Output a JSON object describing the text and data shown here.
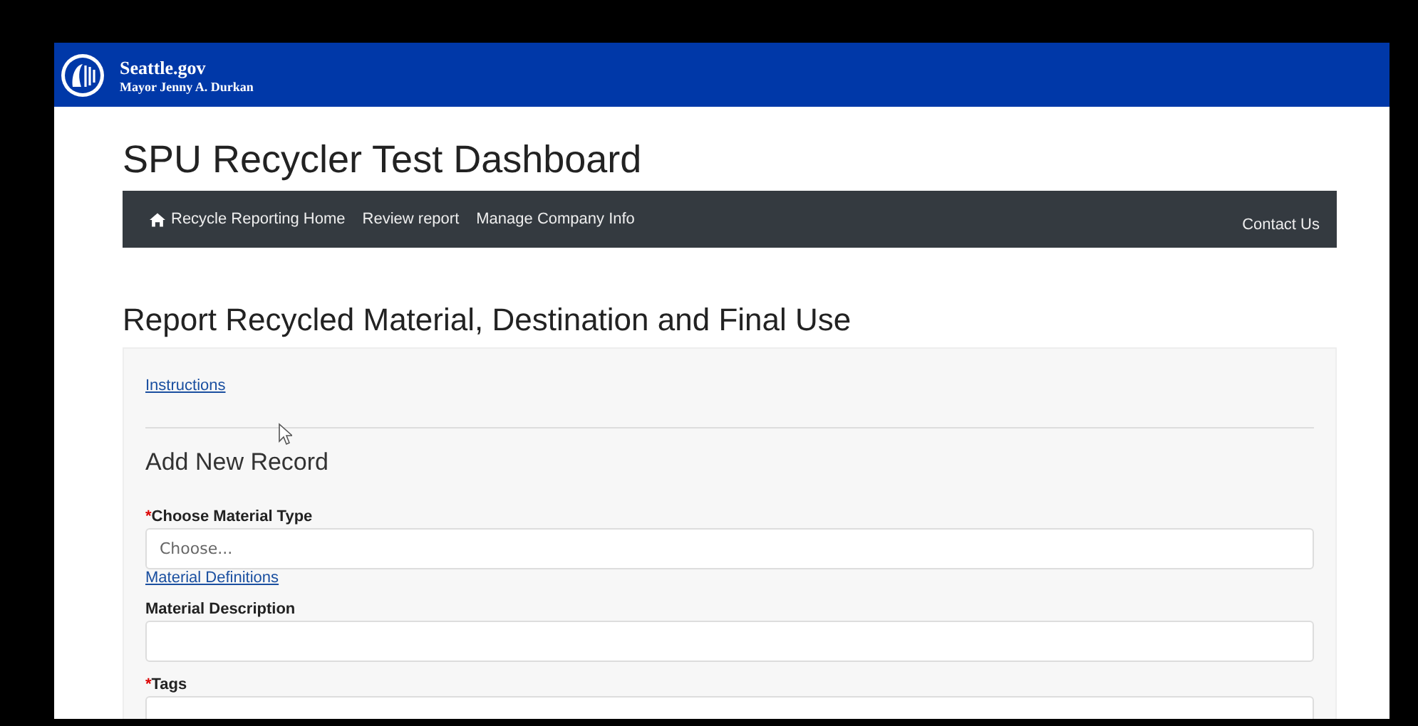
{
  "banner": {
    "site": "Seattle.gov",
    "subtitle": "Mayor Jenny A. Durkan"
  },
  "page_title": "SPU Recycler Test Dashboard",
  "nav": {
    "items": [
      {
        "label": "Recycle Reporting Home",
        "kind": "home"
      },
      {
        "label": "Review report",
        "kind": "link"
      },
      {
        "label": "Manage Company Info",
        "kind": "link"
      }
    ],
    "right": "Contact Us"
  },
  "heading": "Report Recycled Material, Destination and Final Use",
  "form": {
    "instructions_link": "Instructions",
    "section_title": "Add New Record",
    "fields": [
      {
        "label": "Choose Material Type",
        "required": true,
        "required_mark": "*",
        "kind": "select",
        "placeholder": "Choose...",
        "link": "Material Definitions"
      },
      {
        "label": "Material Description",
        "kind": "text"
      },
      {
        "label": "Tags",
        "required": true,
        "required_mark": "*",
        "kind": "text"
      }
    ]
  }
}
